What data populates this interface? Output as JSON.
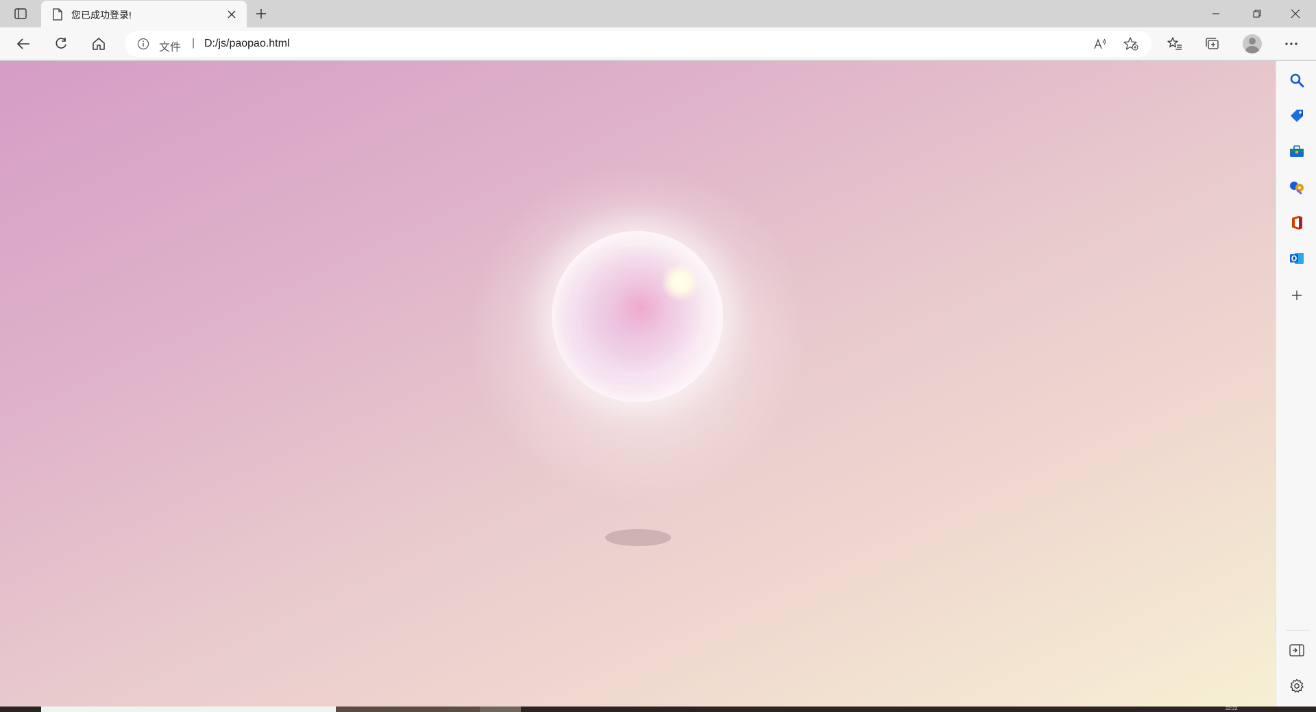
{
  "browser": {
    "tab": {
      "title": "您已成功登录!"
    },
    "address": {
      "scheme_label": "文件",
      "separator": "|",
      "url": "D:/js/paopao.html"
    }
  },
  "colors": {
    "background_top_left": "#d59dc6",
    "background_bottom_right": "#f7f0d3",
    "bubble_highlight": "#fffff0",
    "bubble_core": "#f0a0c8"
  },
  "taskbar": {
    "clock": "22:22"
  }
}
